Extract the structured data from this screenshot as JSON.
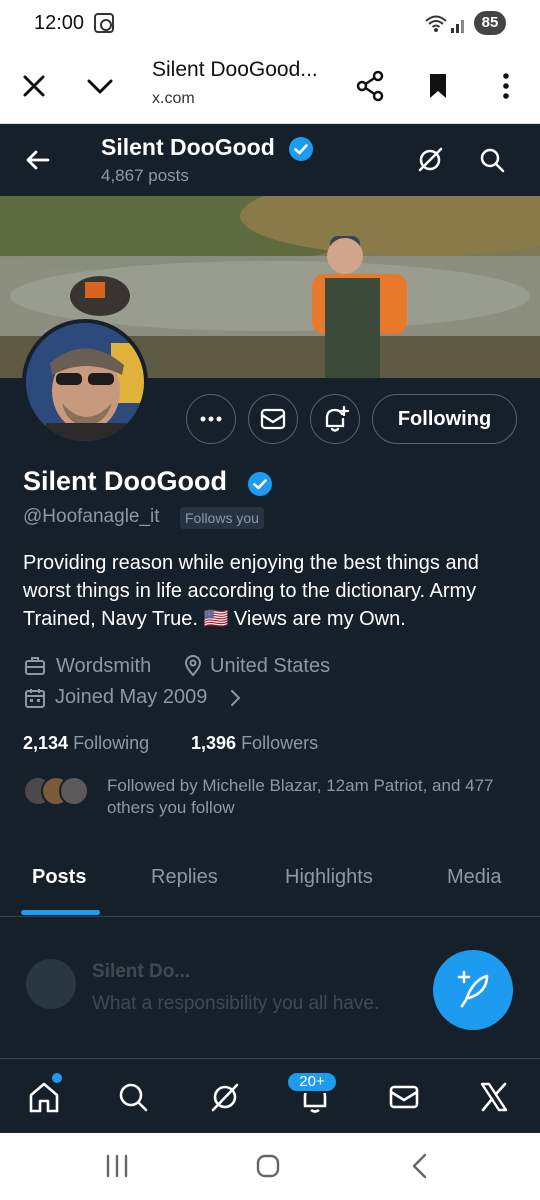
{
  "status_bar": {
    "time": "12:00",
    "battery": "85"
  },
  "browser": {
    "title": "Silent DooGood...",
    "url": "x.com"
  },
  "header": {
    "name": "Silent DooGood",
    "posts": "4,867 posts"
  },
  "profile": {
    "display_name": "Silent DooGood",
    "handle": "@Hoofanagle_it",
    "follows_you": "Follows you",
    "bio": "Providing reason while enjoying the best things and worst things in life according to the dictionary. Army Trained, Navy True. 🇺🇸 Views are my Own.",
    "profession": "Wordsmith",
    "location": "United States",
    "joined": "Joined May 2009",
    "following_count": "2,134",
    "following_label": "Following",
    "followers_count": "1,396",
    "followers_label": "Followers",
    "followed_by": "Followed by Michelle Blazar, 12am Patriot, and 477 others you follow",
    "following_button": "Following"
  },
  "tabs": [
    "Posts",
    "Replies",
    "Highlights",
    "Media"
  ],
  "faded_post": {
    "author": "Silent Do...",
    "text": "What a responsibility you all have."
  },
  "bottom_nav": {
    "notification_badge": "20+"
  },
  "colors": {
    "accent": "#1d9bf0",
    "background": "#15202b",
    "muted": "#8b98a5"
  }
}
